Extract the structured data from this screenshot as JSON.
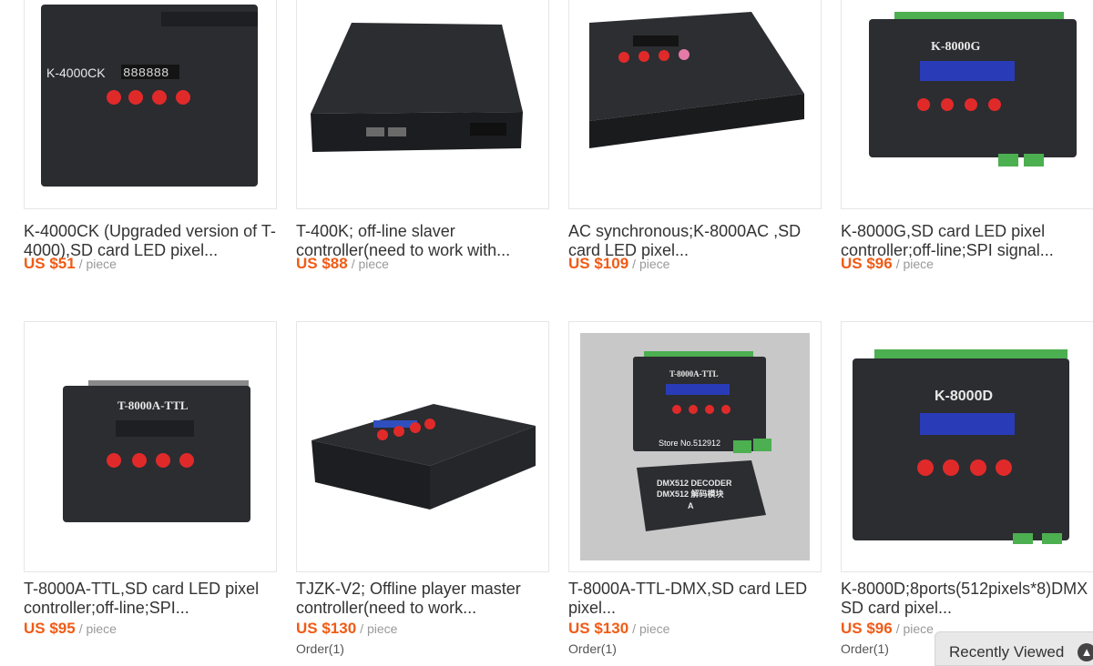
{
  "products": [
    {
      "title_l1": "K-4000CK (Upgraded version of T-",
      "title_l2": "4000),SD card LED pixel...",
      "price": "US $51",
      "unit": "/ piece",
      "orders": "",
      "image_label": "K-4000CK",
      "image_icon": "controller-box-image"
    },
    {
      "title_l1": "T-400K; off-line slaver",
      "title_l2": "controller(need to work with...",
      "price": "US $88",
      "unit": "/ piece",
      "orders": "",
      "image_label": "",
      "image_icon": "controller-box-image"
    },
    {
      "title_l1": "AC synchronous;K-8000AC ,SD",
      "title_l2": "card LED pixel...",
      "price": "US $109",
      "unit": "/ piece",
      "orders": "",
      "image_label": "",
      "image_icon": "controller-box-image"
    },
    {
      "title_l1": "K-8000G,SD card LED pixel",
      "title_l2": "controller;off-line;SPI signal...",
      "price": "US $96",
      "unit": "/ piece",
      "orders": "",
      "image_label": "K-8000G",
      "image_icon": "controller-box-image"
    },
    {
      "title_l1": "T-8000A-TTL,SD card LED pixel",
      "title_l2": "controller;off-line;SPI...",
      "price": "US $95",
      "unit": "/ piece",
      "orders": "",
      "image_label": "T-8000A-TTL",
      "image_icon": "controller-box-image"
    },
    {
      "title_l1": "TJZK-V2; Offline player master",
      "title_l2": "controller(need to work...",
      "price": "US $130",
      "unit": "/ piece",
      "orders": "Order(1)",
      "image_label": "",
      "image_icon": "controller-box-image"
    },
    {
      "title_l1": "T-8000A-TTL-DMX,SD card LED",
      "title_l2": "pixel...",
      "price": "US $130",
      "unit": "/ piece",
      "orders": "Order(1)",
      "image_label": "T-8000A-TTL",
      "image_label2": "DMX512 DECODER",
      "image_label3": "DMX512 解码模块",
      "image_label4": "A",
      "image_watermark": "Store No.512912",
      "image_icon": "controller-with-decoder-image"
    },
    {
      "title_l1": "K-8000D;8ports(512pixels*8)DMX",
      "title_l2": "SD card pixel...",
      "price": "US $96",
      "unit": "/ piece",
      "orders": "Order(1)",
      "image_label": "K-8000D",
      "image_icon": "controller-box-image"
    }
  ],
  "recently_viewed": {
    "label": "Recently Viewed"
  },
  "colors": {
    "price": "#f05b16",
    "title": "#333333",
    "unit": "#999999",
    "device": "#2b2d31"
  }
}
